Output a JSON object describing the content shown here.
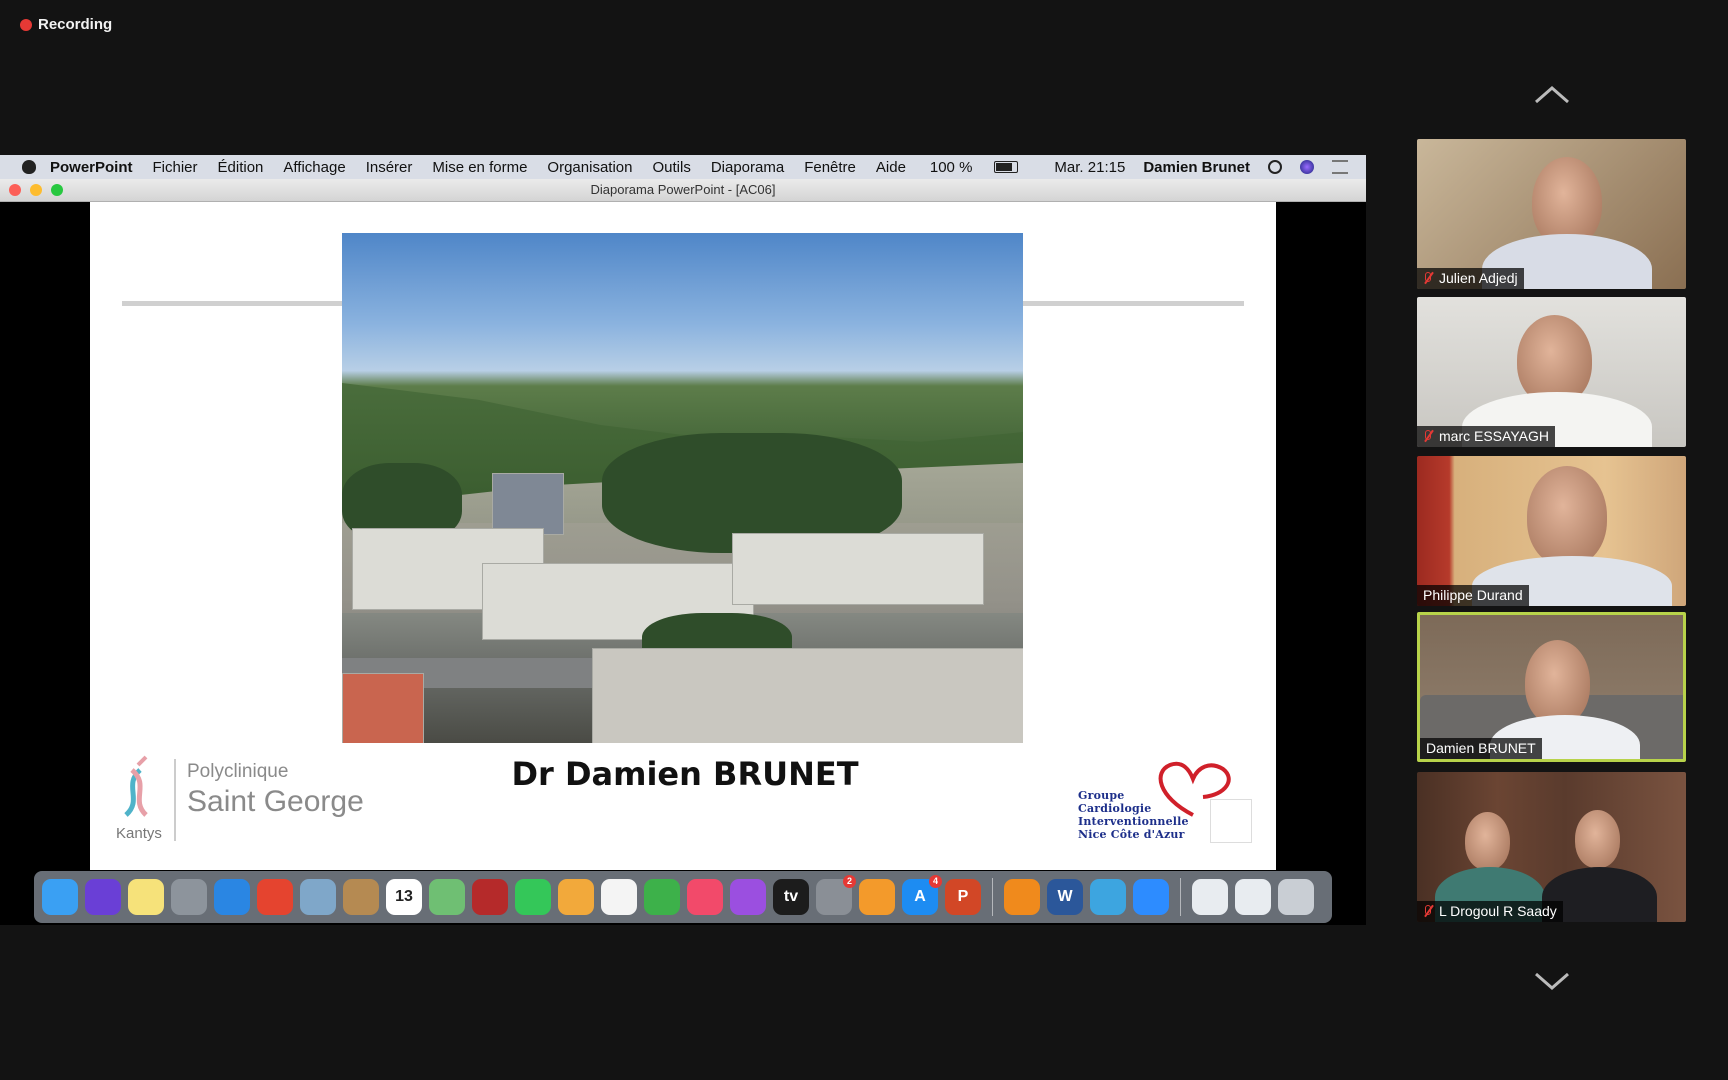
{
  "recording": {
    "label": "Recording",
    "dot_color": "#e53935"
  },
  "mac_menubar": {
    "app": "PowerPoint",
    "items": [
      "Fichier",
      "Édition",
      "Affichage",
      "Insérer",
      "Mise en forme",
      "Organisation",
      "Outils",
      "Diaporama",
      "Fenêtre",
      "Aide"
    ],
    "battery": "100 %",
    "clock": "Mar. 21:15",
    "user": "Damien Brunet"
  },
  "window": {
    "title": "Diaporama PowerPoint - [AC06]"
  },
  "slide": {
    "title": "Dr Damien BRUNET",
    "left_logo": {
      "brand": "Kantys",
      "line1": "Polyclinique",
      "line2": "Saint George"
    },
    "right_logo": {
      "lines": [
        "Groupe",
        "Cardiologie",
        "Interventionnelle",
        "Nice Côte d'Azur"
      ],
      "heart_color": "#d0202a"
    }
  },
  "dock": {
    "items": [
      {
        "icon": "finder-icon",
        "color": "#3aa0f3",
        "glyph": ""
      },
      {
        "icon": "siri-icon",
        "color": "#6a3fd6",
        "glyph": ""
      },
      {
        "icon": "notes-icon",
        "color": "#f6e27a",
        "glyph": ""
      },
      {
        "icon": "launchpad-icon",
        "color": "#8d949c",
        "glyph": ""
      },
      {
        "icon": "safari-icon",
        "color": "#2a86e3",
        "glyph": ""
      },
      {
        "icon": "chrome-icon",
        "color": "#e5442f",
        "glyph": ""
      },
      {
        "icon": "preview-icon",
        "color": "#7fa7c9",
        "glyph": ""
      },
      {
        "icon": "contacts-icon",
        "color": "#b58a52",
        "glyph": ""
      },
      {
        "icon": "calendar-icon",
        "color": "#ffffff",
        "glyph": "13"
      },
      {
        "icon": "maps-icon",
        "color": "#6fbf73",
        "glyph": ""
      },
      {
        "icon": "photo-booth-icon",
        "color": "#b52a2a",
        "glyph": ""
      },
      {
        "icon": "facetime-icon",
        "color": "#34c759",
        "glyph": ""
      },
      {
        "icon": "photos-icon",
        "color": "#f2a93b",
        "glyph": ""
      },
      {
        "icon": "textedit-icon",
        "color": "#f4f4f4",
        "glyph": ""
      },
      {
        "icon": "numbers-icon",
        "color": "#3db14a",
        "glyph": ""
      },
      {
        "icon": "music-icon",
        "color": "#f24a6a",
        "glyph": ""
      },
      {
        "icon": "podcasts-icon",
        "color": "#9b4fe0",
        "glyph": ""
      },
      {
        "icon": "apple-tv-icon",
        "color": "#1c1c1c",
        "glyph": "tv"
      },
      {
        "icon": "system-preferences-icon",
        "color": "#8a8f96",
        "glyph": "",
        "badge": "2"
      },
      {
        "icon": "books-icon",
        "color": "#f39a2b",
        "glyph": ""
      },
      {
        "icon": "app-store-icon",
        "color": "#1d8cf2",
        "glyph": "A",
        "badge": "4"
      },
      {
        "icon": "powerpoint-icon",
        "color": "#d24726",
        "glyph": "P"
      },
      {
        "icon": "vlc-icon",
        "color": "#f08a1c",
        "glyph": ""
      },
      {
        "icon": "word-icon",
        "color": "#2b579a",
        "glyph": "W"
      },
      {
        "icon": "remote-desktop-icon",
        "color": "#3da5e0",
        "glyph": ""
      },
      {
        "icon": "zoom-icon",
        "color": "#2d8cff",
        "glyph": ""
      },
      {
        "icon": "downloads-stack-icon",
        "color": "#e8ecf0",
        "glyph": ""
      },
      {
        "icon": "documents-stack-icon",
        "color": "#e8ecf0",
        "glyph": ""
      },
      {
        "icon": "trash-icon",
        "color": "#c9ced4",
        "glyph": ""
      }
    ]
  },
  "participants": [
    {
      "name": "Julien Adjedj",
      "muted": true,
      "active": false
    },
    {
      "name": "marc ESSAYAGH",
      "muted": true,
      "active": false
    },
    {
      "name": "Philippe Durand",
      "muted": false,
      "active": false
    },
    {
      "name": "Damien BRUNET",
      "muted": false,
      "active": true
    },
    {
      "name": "L Drogoul R Saady",
      "muted": true,
      "active": false
    }
  ],
  "colors": {
    "background": "#131313",
    "active_speaker": "#b8d34a",
    "muted_mic": "#e53935"
  }
}
